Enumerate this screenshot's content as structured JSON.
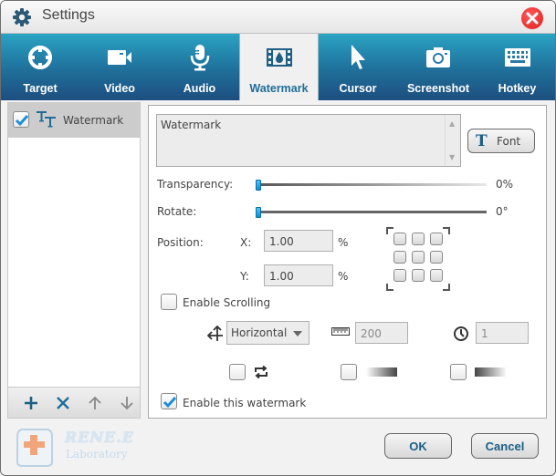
{
  "window": {
    "title": "Settings"
  },
  "tabs": [
    {
      "label": "Target",
      "icon": "target-icon"
    },
    {
      "label": "Video",
      "icon": "video-camera-icon"
    },
    {
      "label": "Audio",
      "icon": "microphone-icon"
    },
    {
      "label": "Watermark",
      "icon": "film-drop-icon",
      "active": true
    },
    {
      "label": "Cursor",
      "icon": "cursor-arrow-icon"
    },
    {
      "label": "Screenshot",
      "icon": "camera-icon"
    },
    {
      "label": "Hotkey",
      "icon": "keyboard-icon"
    }
  ],
  "watermark_list": {
    "items": [
      {
        "label": "Watermark",
        "checked": true,
        "icon": "text-icon"
      }
    ],
    "toolbar": {
      "add": "add-icon",
      "remove": "remove-icon",
      "move_up": "arrow-up-icon",
      "move_down": "arrow-down-icon"
    }
  },
  "editor": {
    "text_value": "Watermark",
    "font_label": "Font",
    "transparency": {
      "label": "Transparency:",
      "value_text": "0%",
      "value": 0
    },
    "rotate": {
      "label": "Rotate:",
      "value_text": "0°",
      "value": 0
    },
    "position": {
      "label": "Position:",
      "x_label": "X:",
      "x_value": "1.00",
      "x_unit": "%",
      "y_label": "Y:",
      "y_value": "1.00",
      "y_unit": "%"
    },
    "scrolling": {
      "enable_label": "Enable Scrolling",
      "enabled": false,
      "direction": "Horizontal",
      "distance": "200",
      "duration": "1",
      "loop_checked": false,
      "fade_in_checked": false,
      "fade_out_checked": false
    },
    "enable_watermark_label": "Enable this watermark",
    "enable_watermark_checked": true
  },
  "footer": {
    "ok_label": "OK",
    "cancel_label": "Cancel",
    "logo_brand": "RENE.E",
    "logo_sub": "Laboratory"
  },
  "colors": {
    "accent": "#1e6d99",
    "tab_gradient_top": "#2aa3c3",
    "tab_gradient_bottom": "#1d4f80",
    "close_red": "#e82828",
    "check_blue": "#1a8fd8"
  }
}
